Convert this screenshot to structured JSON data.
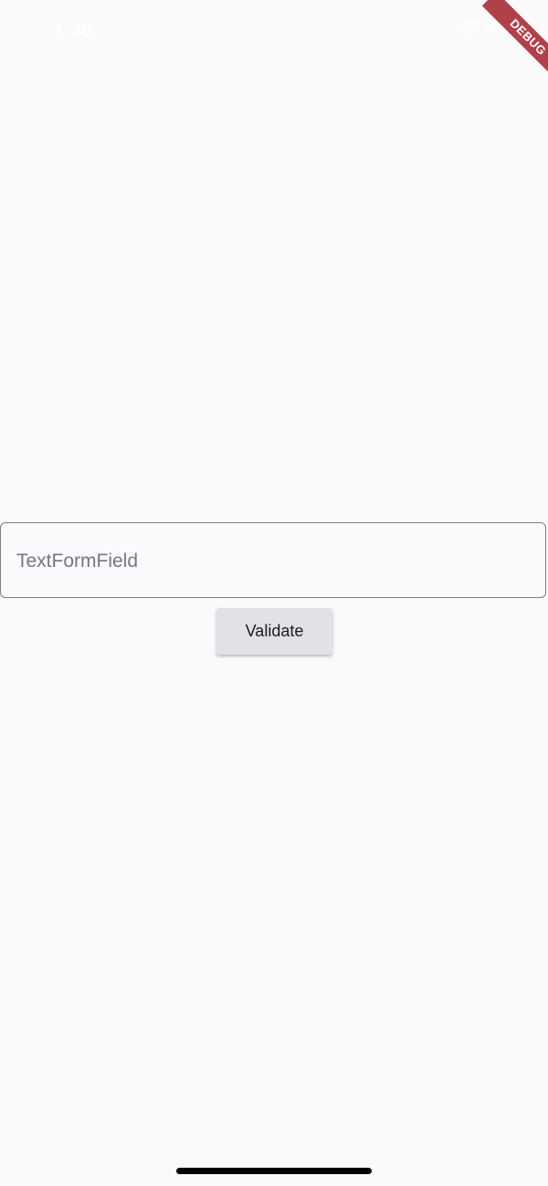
{
  "status_bar": {
    "time": "1:36"
  },
  "debug_banner": {
    "label": "DEBUG",
    "color": "#b0414a"
  },
  "form": {
    "text_field": {
      "placeholder": "TextFormField",
      "value": ""
    },
    "validate_label": "Validate"
  },
  "colors": {
    "background": "#fbf9fc",
    "field_border": "#7f7d83",
    "button_bg": "#e3e1e6"
  }
}
